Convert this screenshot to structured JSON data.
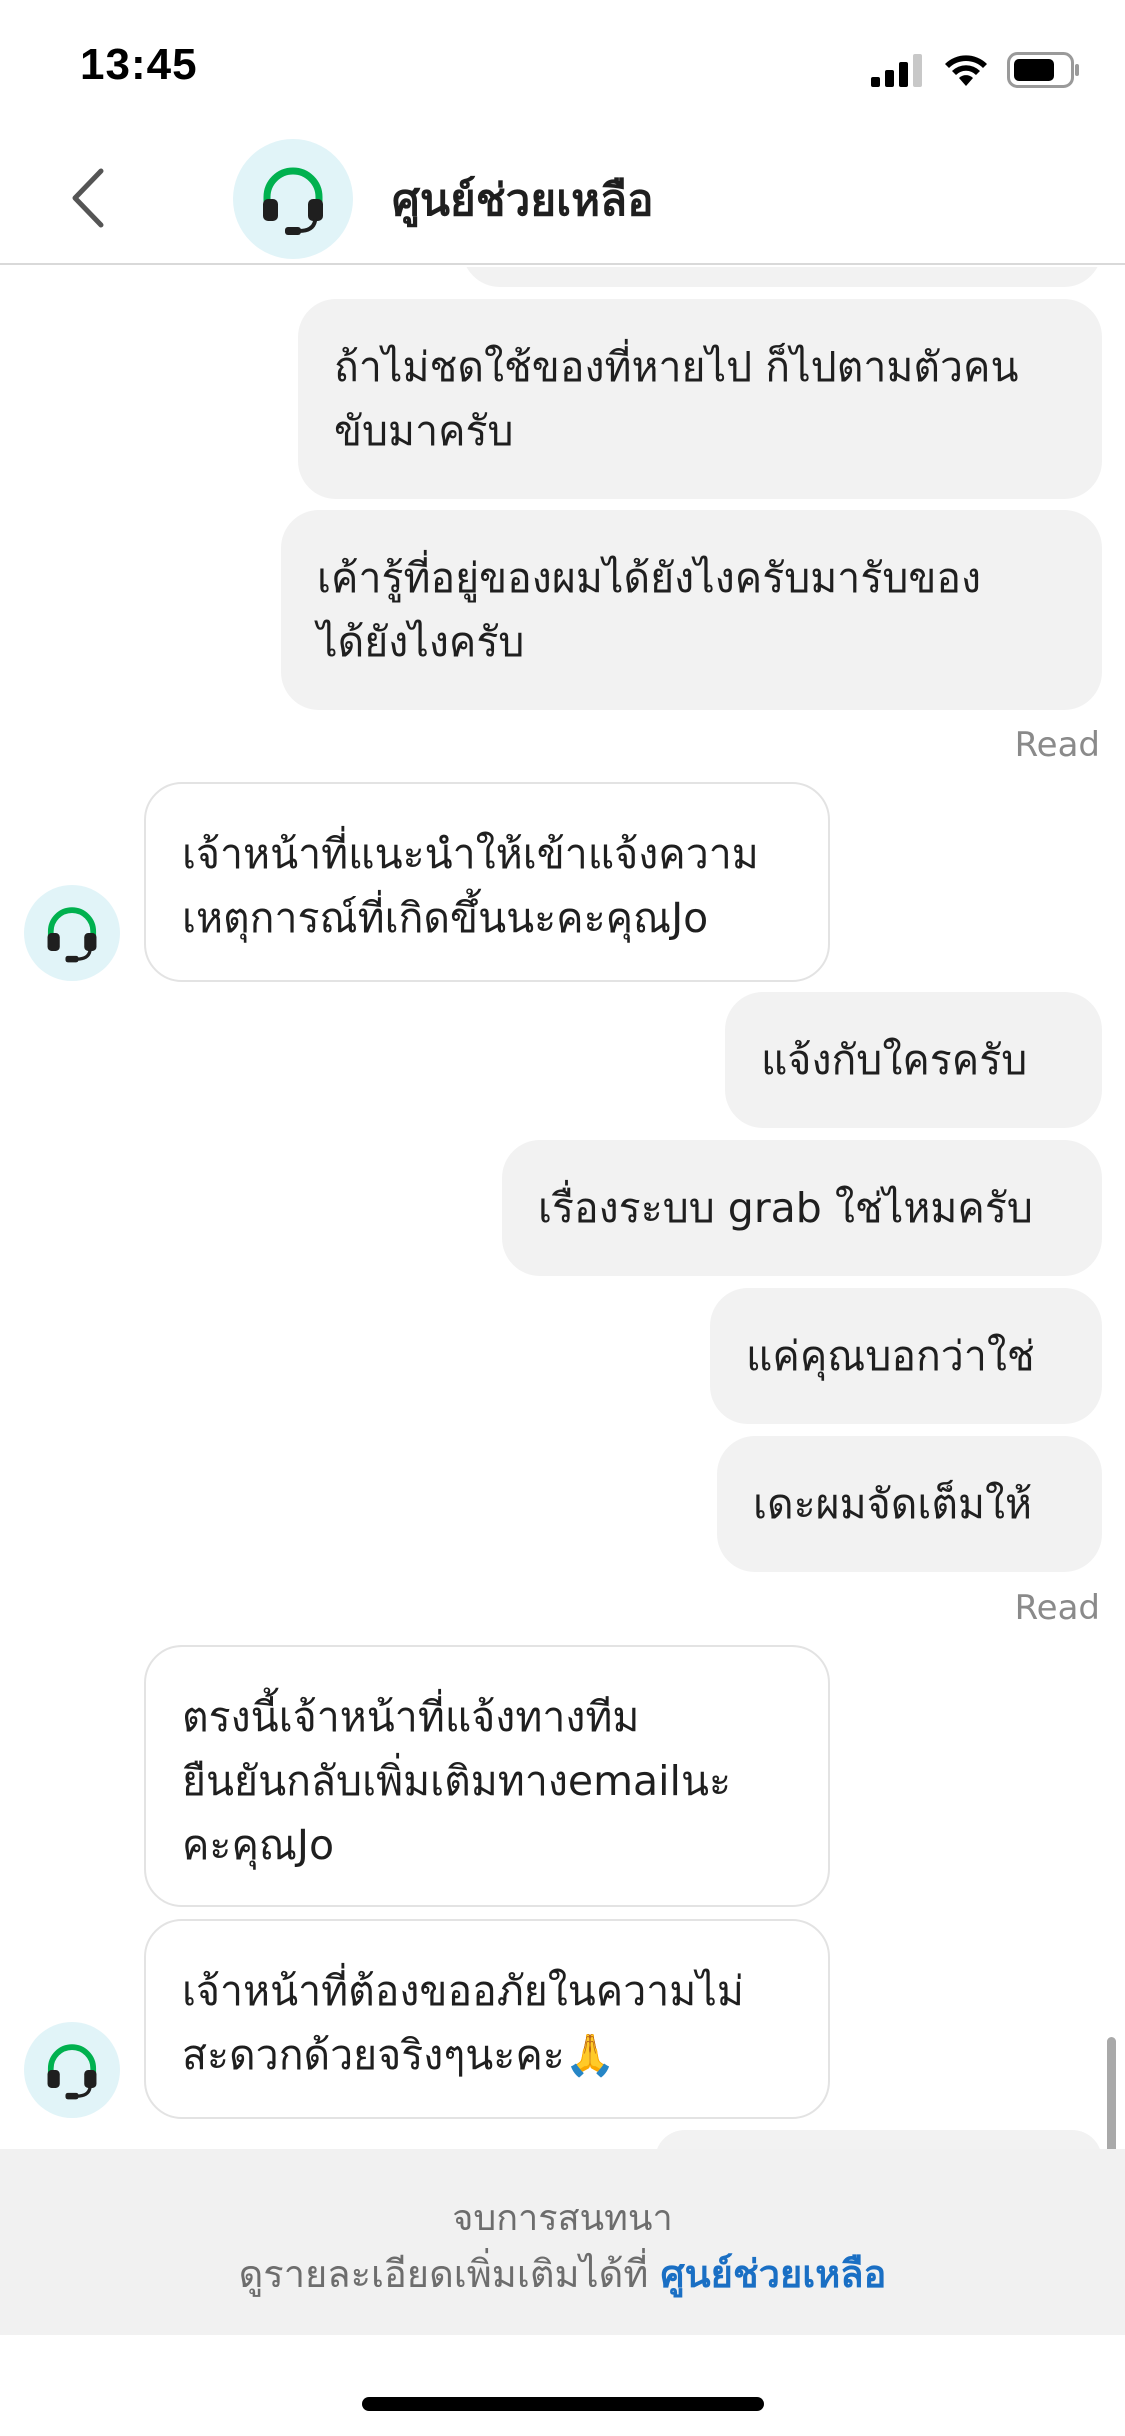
{
  "status_bar": {
    "time": "13:45",
    "icons": [
      "signal-icon",
      "wifi-icon",
      "battery-icon"
    ]
  },
  "header": {
    "back_icon": "chevron-left-icon",
    "avatar_icon": "headset-icon",
    "title": "ศูนย์ช่วยเหลือ"
  },
  "messages": [
    {
      "sender": "user",
      "text": "ถ้าไม่ชดใช้ของที่หายไป ก็ไปตามตัวคน\nขับมาครับ"
    },
    {
      "sender": "user",
      "text": "เค้ารู้ที่อยู่ของผมได้ยังไงครับมารับของ\nได้ยังไงครับ"
    },
    {
      "sender": "support",
      "text": "เจ้าหน้าที่แนะนำให้เข้าแจ้งความ\nเหตุการณ์ที่เกิดขึ้นนะคะคุณJo"
    },
    {
      "sender": "user",
      "text": "แจ้งกับใครครับ"
    },
    {
      "sender": "user",
      "text": "เรื่องระบบ grab ใช่ไหมครับ"
    },
    {
      "sender": "user",
      "text": "แค่คุณบอกว่าใช่"
    },
    {
      "sender": "user",
      "text": "เดะผมจัดเต็มให้"
    },
    {
      "sender": "support",
      "text": "ตรงนี้เจ้าหน้าที่แจ้งทางทีม\nยืนยันกลับเพิ่มเติมทางemailนะ\nคะคุณJo"
    },
    {
      "sender": "support",
      "text": "เจ้าหน้าที่ต้องขออภัยในความไม่\nสะดวกด้วยจริงๆนะคะ🙏"
    }
  ],
  "read_receipts": [
    "Read",
    "Read"
  ],
  "conversation_ended": {
    "title": "จบการสนทนา",
    "detail_prefix": "ดูรายละเอียดเพิ่มเติมได้ที่ ",
    "detail_link": "ศูนย์ช่วยเหลือ"
  },
  "colors": {
    "accent_green": "#00b14f",
    "avatar_bg": "#e1f4f8",
    "link_blue": "#1a6fc4",
    "outgoing_bubble": "#f2f2f2"
  }
}
